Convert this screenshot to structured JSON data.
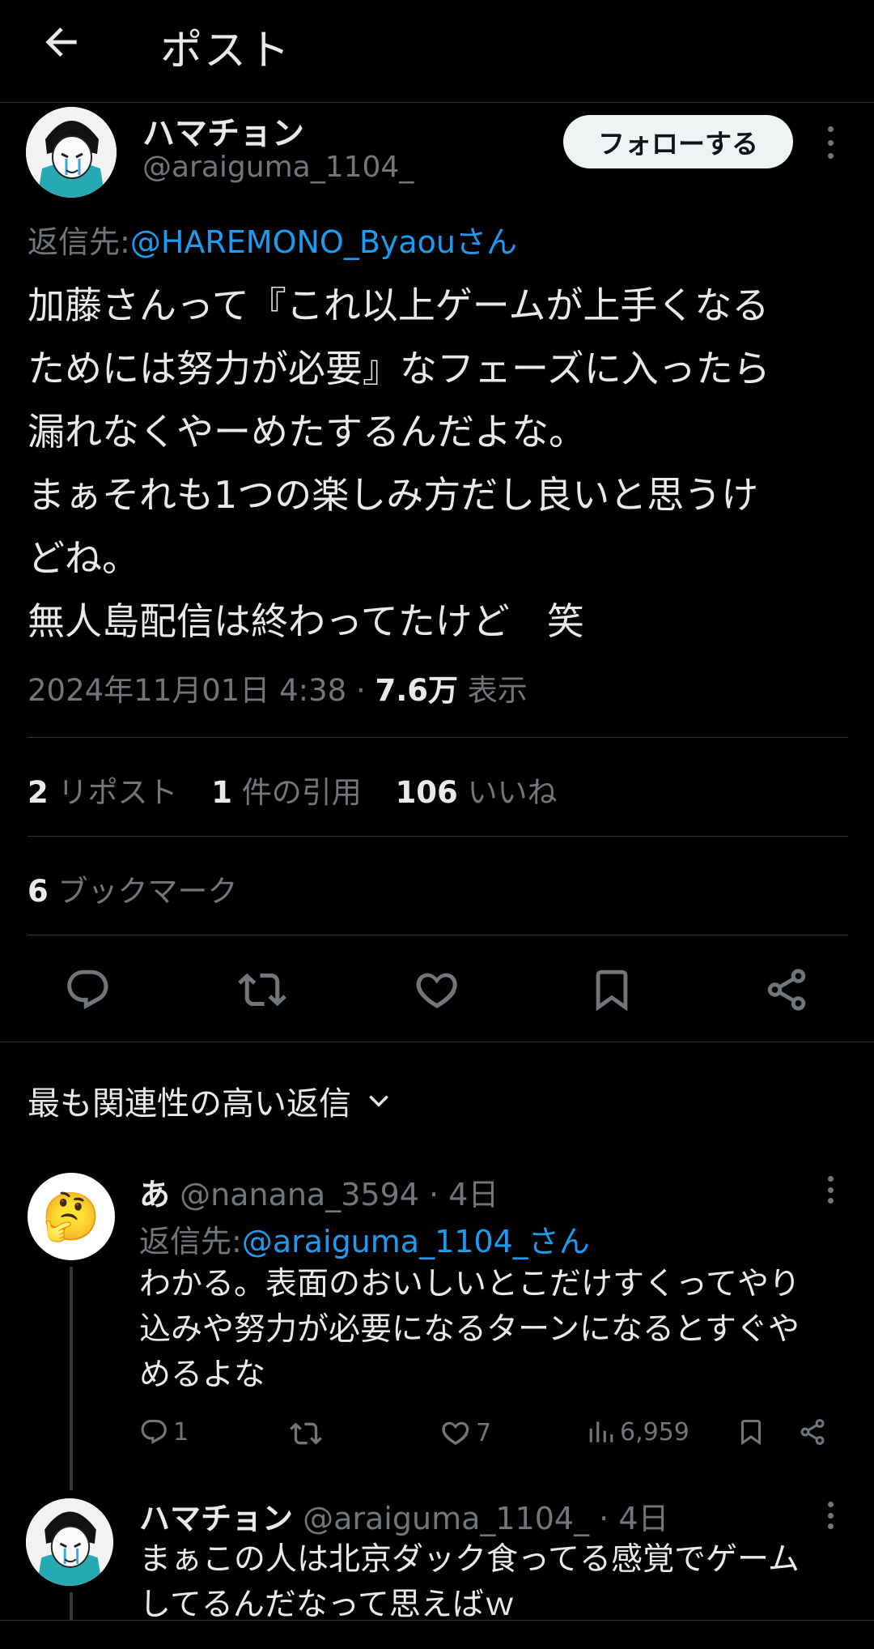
{
  "header": {
    "title": "ポスト"
  },
  "post": {
    "author_name": "ハマチョン",
    "author_handle": "@araiguma_1104_",
    "follow_label": "フォローする",
    "reply_to_prefix": "返信先:",
    "reply_to_handle": "@HAREMONO_Byaouさん",
    "text": "加藤さんって『これ以上ゲームが上手くなる\nためには努力が必要』なフェーズに入ったら\n漏れなくやーめたするんだよな。\nまぁそれも1つの楽しみ方だし良いと思うけ\nどね。\n無人島配信は終わってたけど　笑",
    "timestamp": "2024年11月01日 4:38",
    "separator": " · ",
    "views_count": "7.6万",
    "views_label": "表示",
    "stats": {
      "reposts_count": "2",
      "reposts_label": "リポスト",
      "quotes_count": "1",
      "quotes_label": "件の引用",
      "likes_count": "106",
      "likes_label": "いいね",
      "bookmarks_count": "6",
      "bookmarks_label": "ブックマーク"
    }
  },
  "sort": {
    "label": "最も関連性の高い返信"
  },
  "replies": [
    {
      "author_name": "あ",
      "author_handle": "@nanana_3594",
      "time": "· 4日",
      "avatar_emoji": "🤔",
      "reply_to_prefix": "返信先:",
      "reply_to_handle": "@araiguma_1104_さん",
      "text": "わかる。表面のおいしいとこだけすくってやり\n込みや努力が必要になるターンになるとすぐや\nめるよな",
      "reply_count": "1",
      "like_count": "7",
      "view_count": "6,959"
    },
    {
      "author_name": "ハマチョン",
      "author_handle": "@araiguma_1104_",
      "time": "· 4日",
      "text": "まぁこの人は北京ダック食ってる感覚でゲーム\nしてるんだなって思えばｗ"
    }
  ],
  "colors": {
    "background": "#000000",
    "text": "#e7e9ea",
    "secondary": "#71767b",
    "link": "#1d9bf0",
    "divider": "#2f3336"
  }
}
